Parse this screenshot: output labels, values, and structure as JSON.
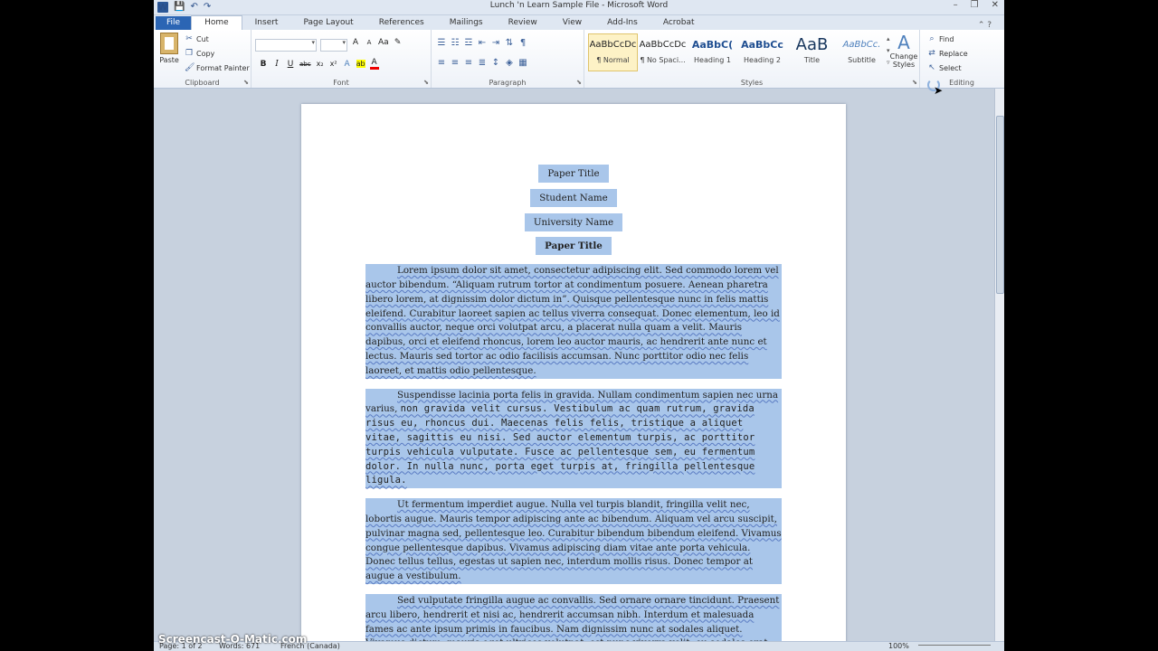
{
  "window": {
    "title": "Lunch 'n Learn Sample File - Microsoft Word",
    "qat": [
      "W",
      "💾",
      "↶",
      "↷"
    ],
    "controls": [
      "–",
      "❐",
      "✕"
    ]
  },
  "tabs": [
    {
      "label": "File"
    },
    {
      "label": "Home"
    },
    {
      "label": "Insert"
    },
    {
      "label": "Page Layout"
    },
    {
      "label": "References"
    },
    {
      "label": "Mailings"
    },
    {
      "label": "Review"
    },
    {
      "label": "View"
    },
    {
      "label": "Add-Ins"
    },
    {
      "label": "Acrobat"
    }
  ],
  "ribbon": {
    "clipboard": {
      "label": "Clipboard",
      "paste": "Paste",
      "cut": "Cut",
      "copy": "Copy",
      "format_painter": "Format Painter"
    },
    "font": {
      "label": "Font",
      "buttons": [
        "B",
        "I",
        "U",
        "abc",
        "x₂",
        "x²",
        "A",
        "ab",
        "A"
      ],
      "grow": "A",
      "shrink": "A",
      "case": "Aa"
    },
    "paragraph": {
      "label": "Paragraph"
    },
    "styles": {
      "label": "Styles",
      "items": [
        {
          "preview": "AaBbCcDc",
          "label": "¶ Normal"
        },
        {
          "preview": "AaBbCcDc",
          "label": "¶ No Spaci..."
        },
        {
          "preview": "AaBbC(",
          "label": "Heading 1"
        },
        {
          "preview": "AaBbCc",
          "label": "Heading 2"
        },
        {
          "preview": "AaB",
          "label": "Title"
        },
        {
          "preview": "AaBbCc.",
          "label": "Subtitle"
        }
      ],
      "change_styles": "Change Styles"
    },
    "editing": {
      "label": "Editing",
      "find": "Find",
      "replace": "Replace",
      "select": "Select"
    }
  },
  "document": {
    "title_lines": [
      "Paper Title",
      "Student Name",
      "University Name"
    ],
    "bold_title": "Paper Title",
    "p1": "Lorem ipsum dolor sit amet, consectetur adipiscing elit. Sed commodo lorem vel auctor bibendum. “Aliquam rutrum tortor at condimentum posuere. Aenean pharetra libero lorem, at dignissim dolor dictum in”. Quisque pellentesque nunc in felis mattis eleifend. Curabitur laoreet sapien ac tellus viverra consequat. Donec elementum, leo id convallis auctor, neque orci volutpat arcu, a placerat nulla quam a velit. Mauris dapibus, orci et eleifend rhoncus, lorem leo auctor mauris, ac hendrerit ante nunc et lectus. Mauris sed tortor ac odio facilisis accumsan. Nunc porttitor odio nec felis laoreet, et mattis odio pellentesque.",
    "p2a": "Suspendisse lacinia porta felis in gravida. Nullam condimentum sapien nec urna varius, ",
    "p2b": "non gravida velit cursus. Vestibulum ac quam rutrum, gravida risus eu, rhoncus dui. Maecenas felis felis, tristique a aliquet vitae, sagittis eu nisi. Sed auctor elementum turpis, ac porttitor turpis vehicula vulputate. Fusce ac pellentesque sem, eu fermentum dolor. In nulla nunc, porta eget turpis at, fringilla pellentesque ligula.",
    "p3": "Ut fermentum imperdiet augue. Nulla vel turpis blandit, fringilla velit nec, lobortis augue. Mauris tempor adipiscing ante ac bibendum. Aliquam vel arcu suscipit, pulvinar magna sed, pellentesque leo. Curabitur bibendum bibendum eleifend. Vivamus congue pellentesque dapibus. Vivamus adipiscing diam vitae ante porta vehicula. Donec tellus tellus, egestas ut sapien nec, interdum mollis risus. Donec tempor at augue a vestibulum.",
    "p4": "Sed vulputate fringilla augue ac convallis. Sed ornare ornare tincidunt. Praesent arcu libero, hendrerit et nisi ac, hendrerit accumsan nibh. Interdum et malesuada fames ac ante ipsum primis in faucibus. Nam dignissim nunc at sodales aliquet. Vivamus dictum, mauris eget ultrices volutpat, est nunc viverra velit, eu sodales erat turpis at tortor. Maecenas"
  },
  "status": {
    "page": "Page: 1 of 2",
    "words": "Words: 671",
    "language": "French (Canada)",
    "zoom": "100%"
  },
  "watermark": "Screencast-O-Matic.com"
}
